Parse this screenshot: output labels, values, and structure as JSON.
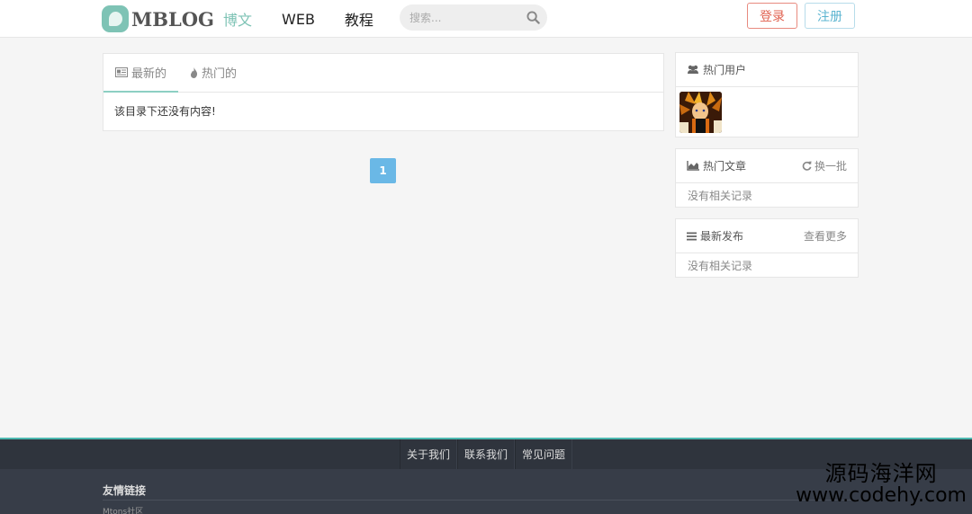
{
  "header": {
    "logo_text": "MBLOG",
    "nav": [
      "博文",
      "WEB",
      "教程"
    ],
    "search_placeholder": "搜索...",
    "login_label": "登录",
    "register_label": "注册"
  },
  "main": {
    "tabs": [
      {
        "label": "最新的",
        "icon": "newspaper-icon"
      },
      {
        "label": "热门的",
        "icon": "fire-icon"
      }
    ],
    "empty_message": "该目录下还没有内容!",
    "pagination_current": "1"
  },
  "sidebar": {
    "hot_users_title": "热门用户",
    "hot_articles_title": "热门文章",
    "refresh_label": "换一批",
    "hot_articles_empty": "没有相关记录",
    "latest_title": "最新发布",
    "more_label": "查看更多",
    "latest_empty": "没有相关记录"
  },
  "footer": {
    "links": [
      "关于我们",
      "联系我们",
      "常见问题"
    ],
    "friends_title": "友情链接",
    "friends": [
      "Mtons社区"
    ]
  },
  "watermark": {
    "cn": "源码海洋网",
    "url": "www.codehy.com"
  },
  "colors": {
    "accent": "#7ec3b5",
    "login": "#e0614f",
    "register": "#5bb4d0",
    "pager": "#6ab8e6",
    "footer_bg": "#373d48"
  }
}
